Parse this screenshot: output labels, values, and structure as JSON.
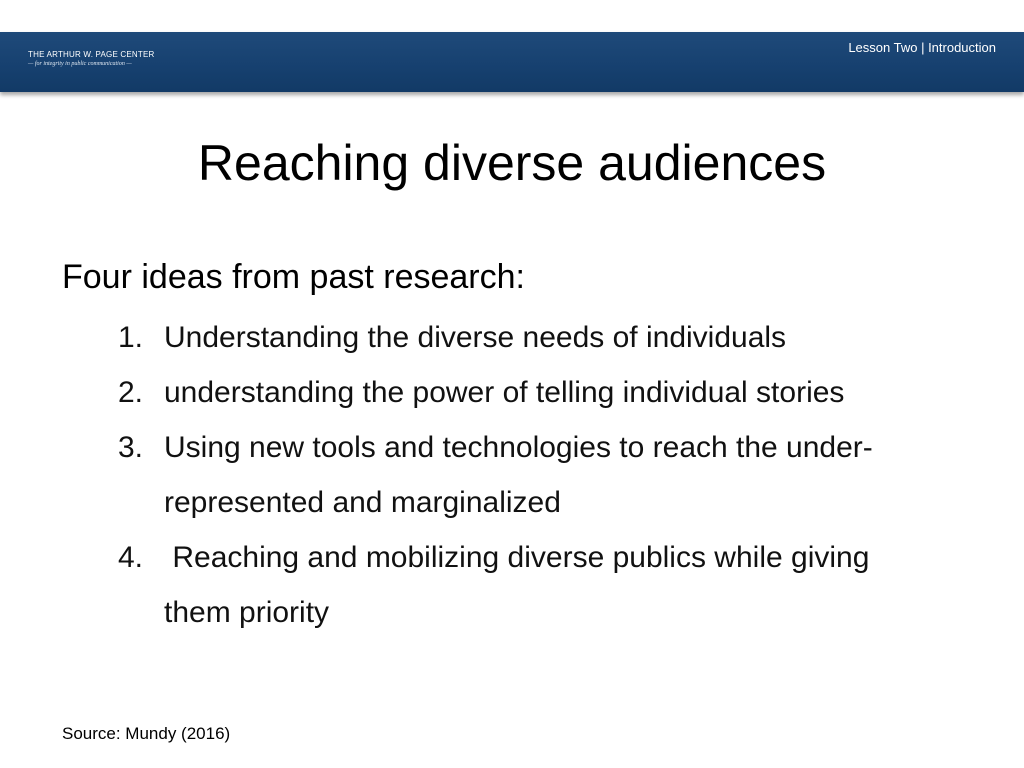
{
  "header": {
    "logo_line1": "THE ARTHUR W. PAGE CENTER",
    "logo_line2": "— for integrity in public communication —",
    "lesson_label": "Lesson Two | Introduction"
  },
  "slide": {
    "title": "Reaching diverse audiences",
    "intro": "Four ideas from past research:",
    "items": [
      {
        "number": "1.",
        "text": "Understanding the diverse needs of individuals"
      },
      {
        "number": "2.",
        "text": "understanding the power of telling individual stories"
      },
      {
        "number": "3.",
        "text": "Using new tools and technologies to reach the under-represented and marginalized"
      },
      {
        "number": "4.",
        "text": " Reaching and mobilizing diverse publics while giving them priority"
      }
    ],
    "source": "Source: Mundy (2016)"
  },
  "colors": {
    "header_blue": "#1a4474",
    "text": "#000000",
    "background": "#ffffff"
  }
}
